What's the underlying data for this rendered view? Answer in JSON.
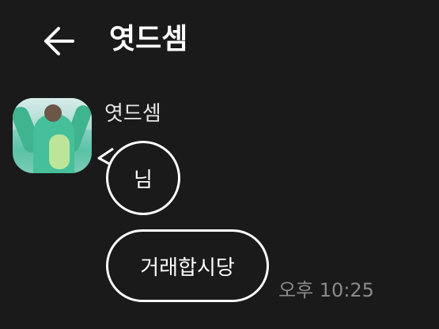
{
  "header": {
    "back_icon": "arrow-left-icon",
    "title": "엿드셈"
  },
  "chat": {
    "sender_name": "엿드셈",
    "messages": [
      {
        "text": "님"
      },
      {
        "text": "거래합시당"
      }
    ],
    "timestamp": "오후 10:25"
  },
  "colors": {
    "background": "#1a1a1a",
    "bubble_border": "#ffffff",
    "text": "#ffffff",
    "timestamp": "#8a8a8a"
  }
}
